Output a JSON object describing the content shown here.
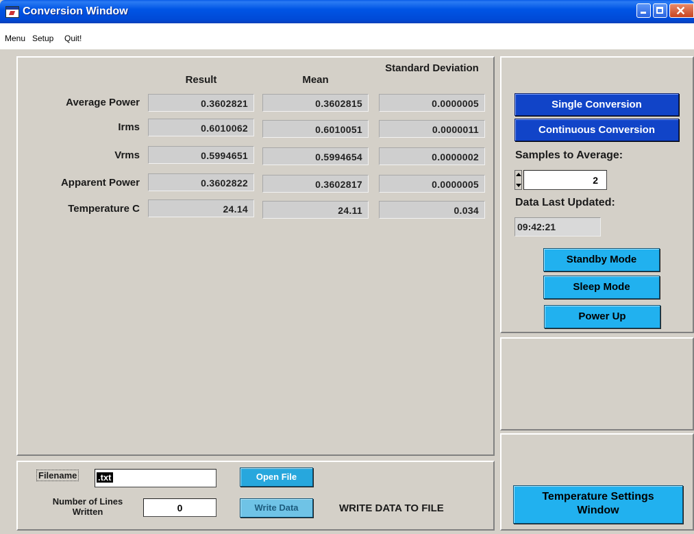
{
  "window": {
    "title": "Conversion Window"
  },
  "menu": {
    "items": [
      "Menu",
      "Setup",
      "Quit!"
    ]
  },
  "table": {
    "columns": [
      "Result",
      "Mean",
      "Standard Deviation"
    ],
    "rows": [
      {
        "label": "Average Power",
        "result": "0.3602821",
        "mean": "0.3602815",
        "std": "0.0000005"
      },
      {
        "label": "Irms",
        "result": "0.6010062",
        "mean": "0.6010051",
        "std": "0.0000011"
      },
      {
        "label": "Vrms",
        "result": "0.5994651",
        "mean": "0.5994654",
        "std": "0.0000002"
      },
      {
        "label": "Apparent Power",
        "result": "0.3602822",
        "mean": "0.3602817",
        "std": "0.0000005"
      },
      {
        "label": "Temperature C",
        "result": "24.14",
        "mean": "24.11",
        "std": "0.034"
      }
    ]
  },
  "controls": {
    "single_conversion": "Single Conversion",
    "continuous_conversion": "Continuous Conversion",
    "samples_label": "Samples to Average:",
    "samples_value": "2",
    "last_updated_label": "Data Last Updated:",
    "last_updated_value": "09:42:21",
    "standby": "Standby Mode",
    "sleep": "Sleep Mode",
    "power_up": "Power Up",
    "temp_settings": "Temperature Settings Window"
  },
  "file": {
    "filename_label": "Filename",
    "filename_value": ".txt",
    "open_file": "Open File",
    "lines_label": "Number of Lines Written",
    "lines_value": "0",
    "write_data": "Write Data",
    "write_to_file_label": "WRITE DATA TO FILE"
  },
  "colors": {
    "titlebar": "#0055e5",
    "button_dark": "#1144c8",
    "button_cyan": "#21b1ef",
    "panel": "#d4d0c8"
  }
}
